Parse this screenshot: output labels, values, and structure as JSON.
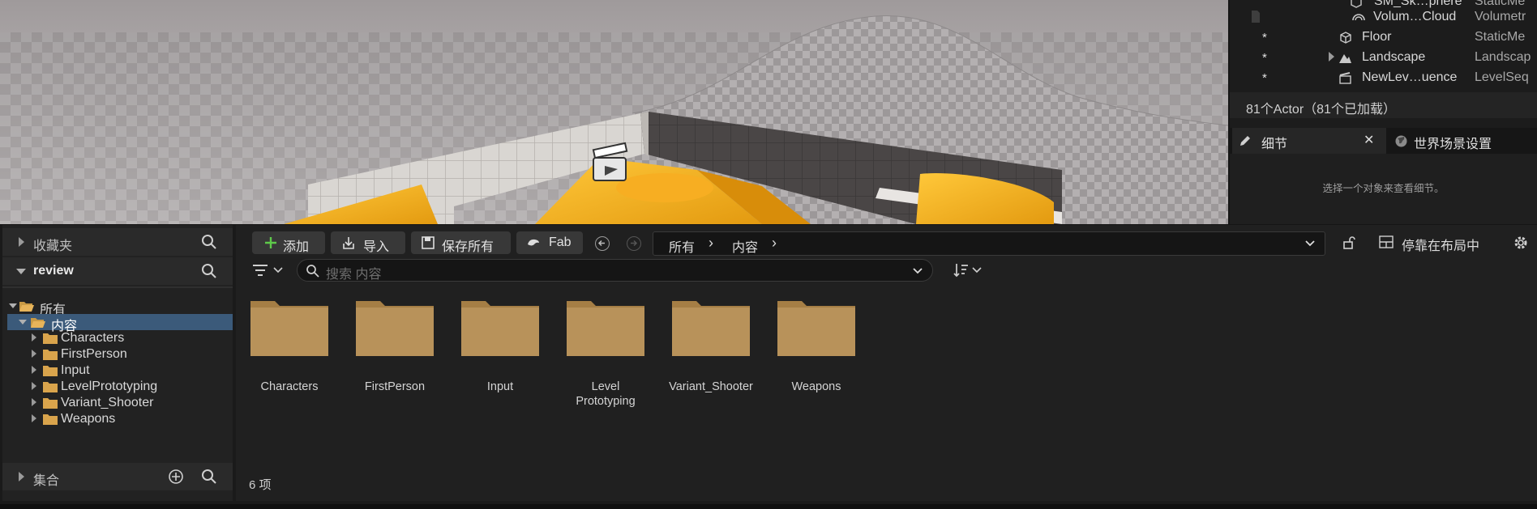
{
  "outliner": {
    "rows": [
      {
        "star": "",
        "name": "SM_Sk…phere",
        "type": "StaticMe",
        "icon": "static-mesh-icon"
      },
      {
        "star": "",
        "name": "Volum…Cloud",
        "type": "Volumetr",
        "icon": "cloud-icon"
      },
      {
        "star": "*",
        "name": "Floor",
        "type": "StaticMe",
        "icon": "static-mesh-icon"
      },
      {
        "star": "*",
        "name": "Landscape",
        "type": "Landscap",
        "icon": "landscape-icon"
      },
      {
        "star": "*",
        "name": "NewLev…uence",
        "type": "LevelSeq",
        "icon": "level-sequence-icon"
      }
    ],
    "actor_count": "81个Actor（81个已加载）"
  },
  "details": {
    "tab_details": "细节",
    "tab_world": "世界场景设置",
    "hint": "选择一个对象来查看细节。"
  },
  "content_browser": {
    "favorites_label": "收藏夹",
    "project_label": "review",
    "collections_label": "集合",
    "tree": {
      "root": "所有",
      "content": "内容",
      "children": [
        "Characters",
        "FirstPerson",
        "Input",
        "LevelPrototyping",
        "Variant_Shooter",
        "Weapons"
      ]
    },
    "toolbar": {
      "add": "添加",
      "import": "导入",
      "save_all": "保存所有",
      "fab": "Fab",
      "dock": "停靠在布局中"
    },
    "path": {
      "all": "所有",
      "content": "内容"
    },
    "search_placeholder": "搜索 内容",
    "assets": [
      "Characters",
      "FirstPerson",
      "Input",
      "Level\nPrototyping",
      "Variant_Shooter",
      "Weapons"
    ],
    "item_count": "6 项"
  }
}
